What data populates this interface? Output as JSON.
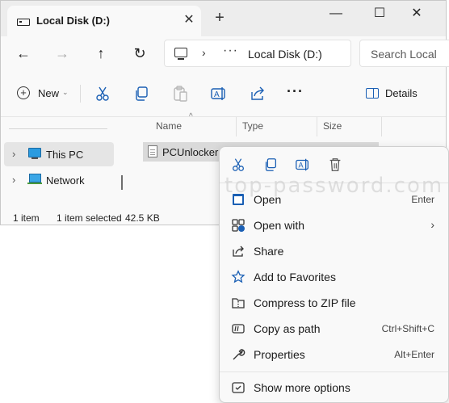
{
  "window": {
    "tab_title": "Local Disk (D:)",
    "tab_close": "✕",
    "new_tab": "+",
    "minimize": "—",
    "maximize": "☐",
    "close": "✕"
  },
  "navbar": {
    "back": "←",
    "forward": "→",
    "up": "↑",
    "refresh": "↻",
    "address_chevron": "›",
    "address_more": "···",
    "address": "Local Disk (D:)",
    "search_placeholder": "Search Local"
  },
  "commandbar": {
    "new_label": "New",
    "new_caret": "⌄",
    "more": "···",
    "details_label": "Details"
  },
  "navpane": {
    "items": [
      {
        "label": "This PC",
        "chevron": "›"
      },
      {
        "label": "Network",
        "chevron": "›"
      }
    ]
  },
  "list": {
    "columns": [
      "Name",
      "Type",
      "Size"
    ],
    "sort_arrow": "^",
    "files": [
      {
        "name": "PCUnlocker"
      }
    ]
  },
  "status": {
    "count": "1 item",
    "selected": "1 item selected",
    "size": "42.5 KB"
  },
  "context_menu": {
    "items": [
      {
        "label": "Open",
        "shortcut": "Enter"
      },
      {
        "label": "Open with",
        "submenu": "›"
      },
      {
        "label": "Share"
      },
      {
        "label": "Add to Favorites"
      },
      {
        "label": "Compress to ZIP file"
      },
      {
        "label": "Copy as path",
        "shortcut": "Ctrl+Shift+C"
      },
      {
        "label": "Properties",
        "shortcut": "Alt+Enter"
      },
      {
        "label": "Show more options"
      }
    ]
  },
  "watermark": "top-password.com",
  "colors": {
    "accent": "#1a5fb4",
    "highlight": "#ffff33",
    "selection": "#dadada"
  }
}
